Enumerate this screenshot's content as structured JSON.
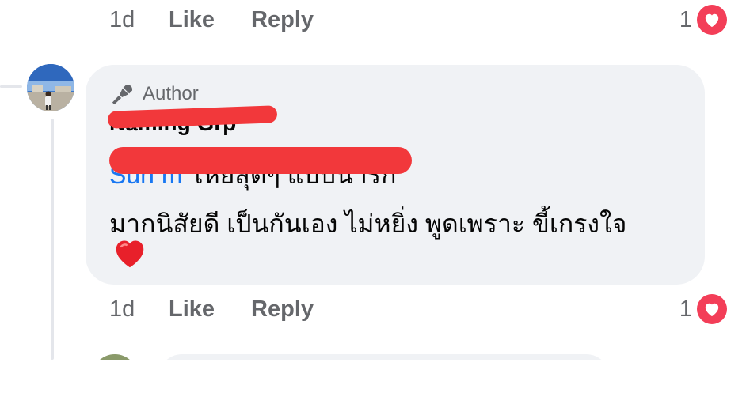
{
  "prev_comment": {
    "time": "1d",
    "like_label": "Like",
    "reply_label": "Reply",
    "reaction_count": "1",
    "reaction_icon": "heart-reaction-icon"
  },
  "comment": {
    "badge_label": "Author",
    "badge_icon": "microphone-icon",
    "author_name": "Naming Grp",
    "mention": "Sun                                      m",
    "text_line1": " โหยสุดๆ แบบน่ารัก",
    "text_line2": "มากนิสัยดี เป็นกันเอง ไม่หยิ่ง พูดเพราะ ขี้เกรงใจ",
    "emoji": "heart-emoji",
    "time": "1d",
    "like_label": "Like",
    "reply_label": "Reply",
    "reaction_count": "1",
    "reaction_icon": "heart-reaction-icon"
  },
  "colors": {
    "bubble_bg": "#f0f2f5",
    "mention": "#1877f2",
    "meta_text": "#65676b",
    "reaction_red": "#f33e58",
    "redaction": "#f2383b"
  }
}
